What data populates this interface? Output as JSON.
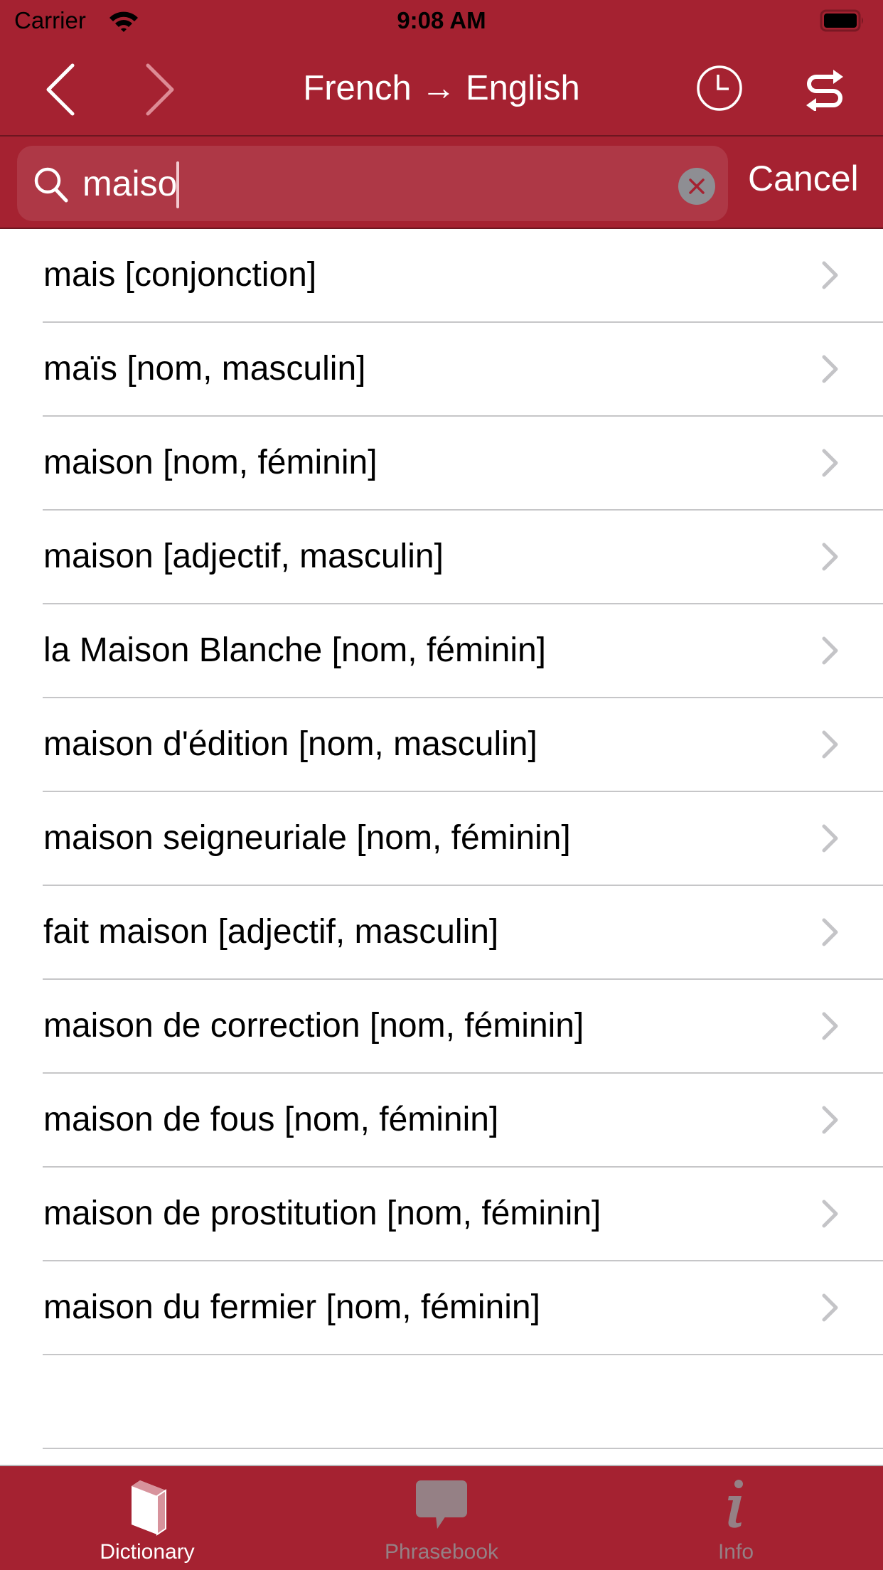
{
  "status_bar": {
    "carrier": "Carrier",
    "time": "9:08 AM",
    "wifi_icon": "wifi-icon",
    "battery_icon": "battery-icon"
  },
  "nav": {
    "title": "French → English",
    "back_icon": "chevron-left-icon",
    "forward_icon": "chevron-right-icon",
    "history_icon": "clock-icon",
    "swap_icon": "swap-direction-icon"
  },
  "search": {
    "value": "maiso",
    "placeholder": "",
    "clear_icon": "clear-circle-icon",
    "cancel_label": "Cancel"
  },
  "results": [
    {
      "label": "mais [conjonction]"
    },
    {
      "label": "maïs [nom, masculin]"
    },
    {
      "label": "maison [nom, féminin]"
    },
    {
      "label": "maison [adjectif, masculin]"
    },
    {
      "label": "la Maison Blanche [nom, féminin]"
    },
    {
      "label": "maison d'édition [nom, masculin]"
    },
    {
      "label": "maison seigneuriale [nom, féminin]"
    },
    {
      "label": "fait maison [adjectif, masculin]"
    },
    {
      "label": "maison de correction [nom, féminin]"
    },
    {
      "label": "maison de fous [nom, féminin]"
    },
    {
      "label": "maison de prostitution [nom, féminin]"
    },
    {
      "label": "maison du fermier [nom, féminin]"
    }
  ],
  "tabs": [
    {
      "label": "Dictionary",
      "icon": "book-icon",
      "active": true
    },
    {
      "label": "Phrasebook",
      "icon": "speech-bubble-icon",
      "active": false
    },
    {
      "label": "Info",
      "icon": "info-icon",
      "active": false
    }
  ],
  "colors": {
    "brand": "#a52231",
    "active_tab": "#ffffff",
    "inactive_tab": "#958085",
    "separator": "#c6c6c8"
  }
}
